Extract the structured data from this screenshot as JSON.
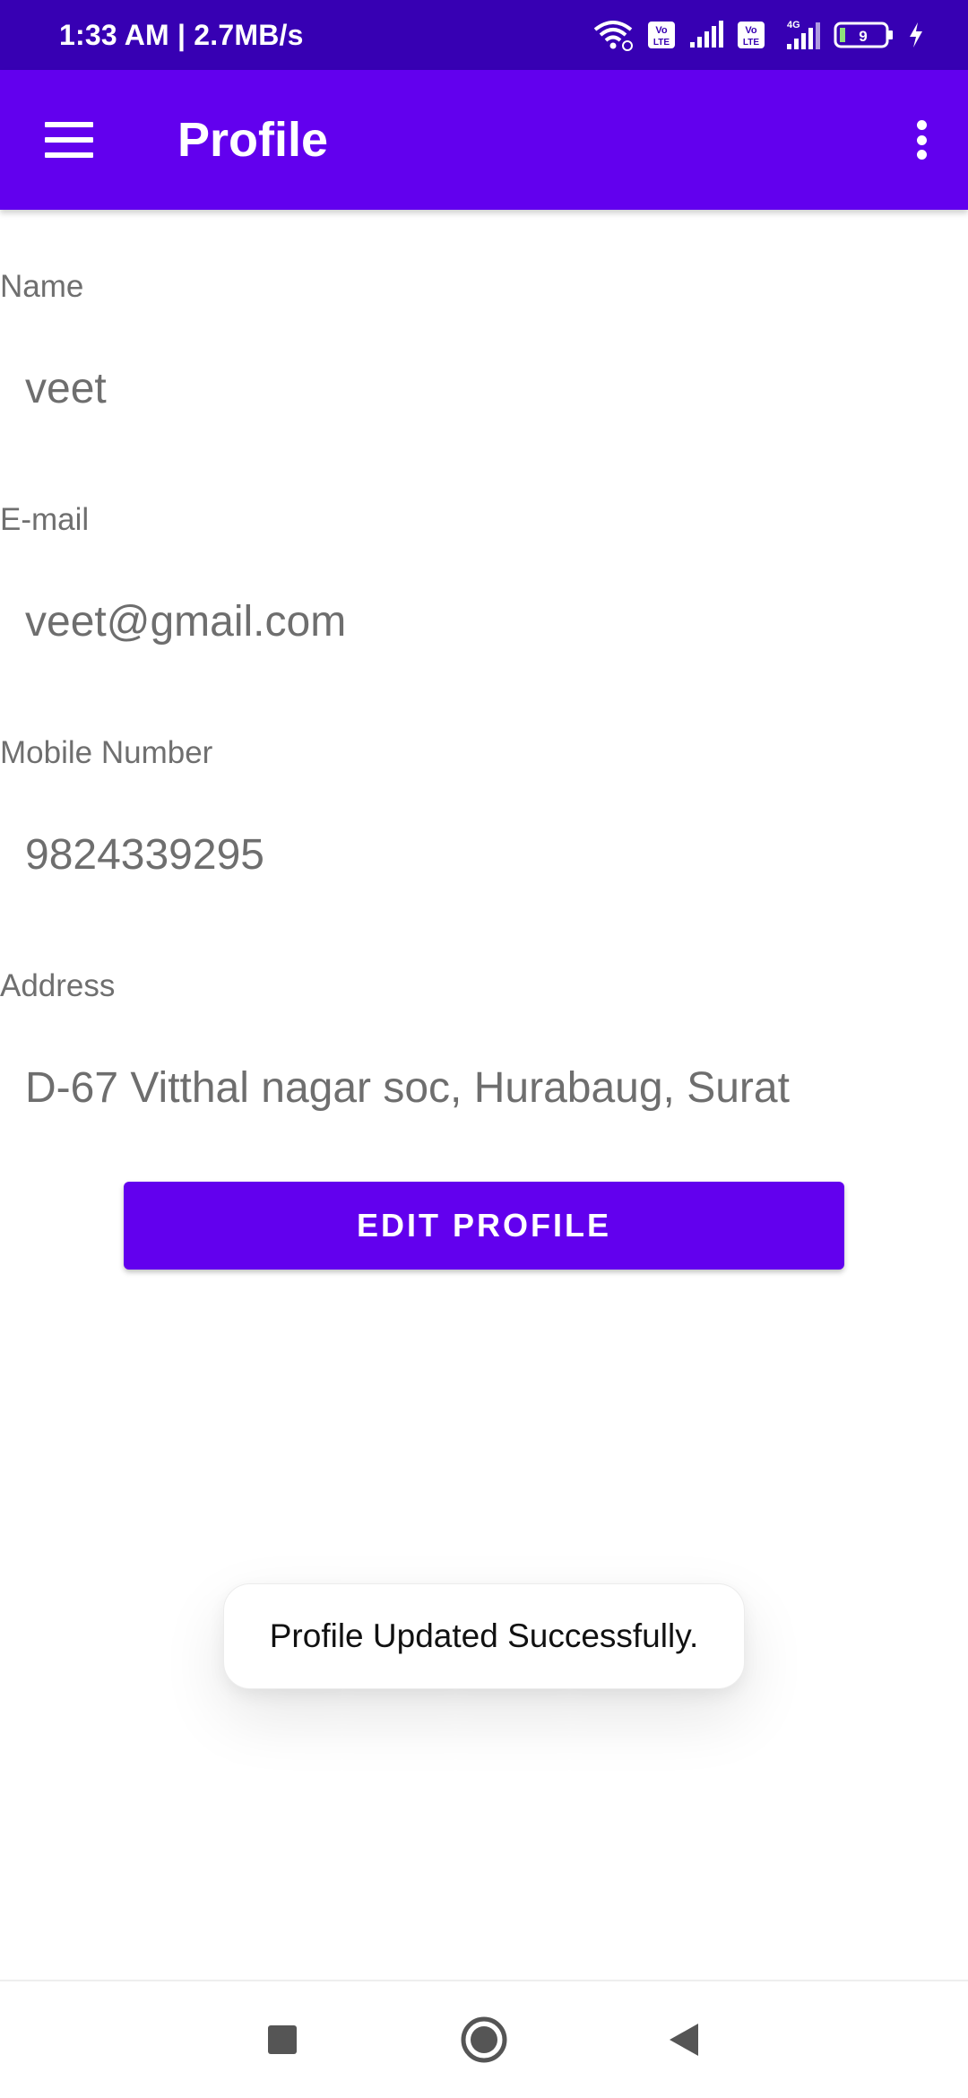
{
  "status_bar": {
    "time_speed": "1:33 AM | 2.7MB/s",
    "battery_level": "9",
    "network_label": "4G",
    "volte_label": "Vo LTE"
  },
  "app_bar": {
    "title": "Profile",
    "color": "#6200ee"
  },
  "profile": {
    "fields": [
      {
        "label": "Name",
        "value": "veet"
      },
      {
        "label": "E-mail",
        "value": "veet@gmail.com"
      },
      {
        "label": "Mobile Number",
        "value": "9824339295"
      },
      {
        "label": "Address",
        "value": "D-67 Vitthal nagar soc, Hurabaug, Surat"
      }
    ],
    "edit_button_label": "EDIT PROFILE"
  },
  "toast": {
    "message": "Profile Updated Successfully."
  },
  "nav_bar": {
    "icons": [
      "recents-square-icon",
      "home-circle-icon",
      "back-triangle-icon"
    ]
  }
}
